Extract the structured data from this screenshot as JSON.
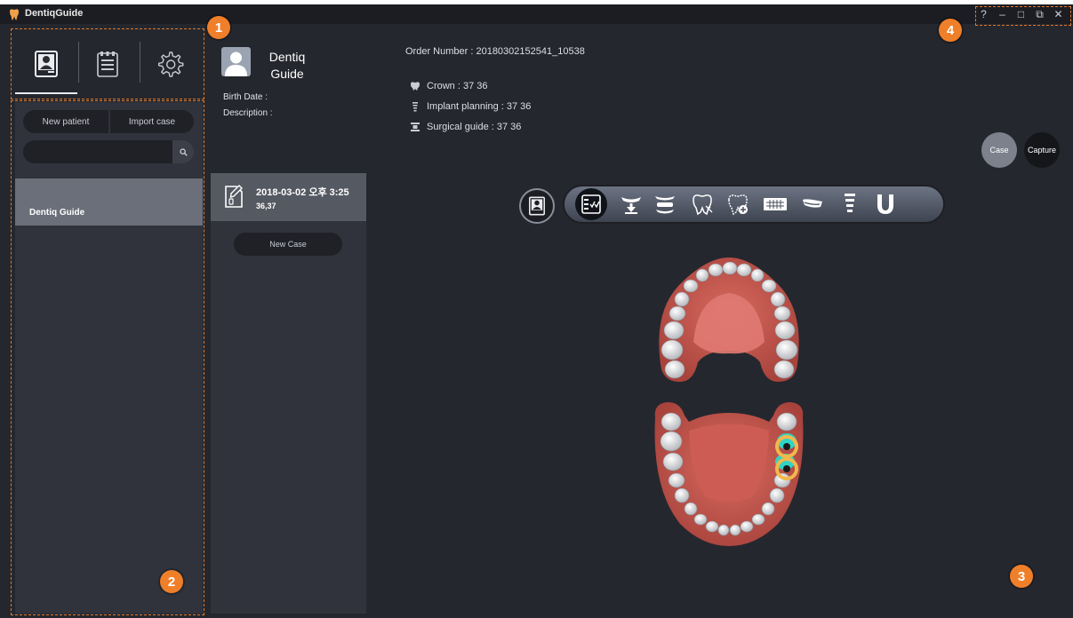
{
  "window": {
    "title": "DentiqGuide"
  },
  "controls": {
    "help": "?",
    "minimize": "–",
    "maximize": "□",
    "restore": "⧉",
    "close": "✕"
  },
  "sidebar": {
    "tabs": [
      "patient-tab",
      "schedule-tab",
      "settings-tab"
    ],
    "new_patient": "New patient",
    "import_case": "Import case",
    "search": {
      "value": "",
      "placeholder": ""
    },
    "patients": [
      {
        "name": "Dentiq  Guide"
      }
    ]
  },
  "patient": {
    "name_line1": "Dentiq",
    "name_line2": "Guide",
    "birth_label": "Birth Date :",
    "desc_label": "Description :"
  },
  "cases": {
    "items": [
      {
        "date": "2018-03-02 오후 3:25",
        "teeth": "36,37"
      }
    ],
    "new_case": "New Case"
  },
  "order": {
    "line": "Order Number : 20180302152541_10538",
    "crown": "Crown : 37 36",
    "implant": "Implant planning : 37 36",
    "guide": "Surgical guide : 37 36"
  },
  "actions": {
    "case": "Case",
    "capture": "Capture"
  },
  "markers": [
    "1",
    "2",
    "3",
    "4"
  ],
  "colors": {
    "accent": "#f07f2a",
    "background": "#25272e",
    "panel": "#30333b",
    "selected": "#6b6f79"
  }
}
